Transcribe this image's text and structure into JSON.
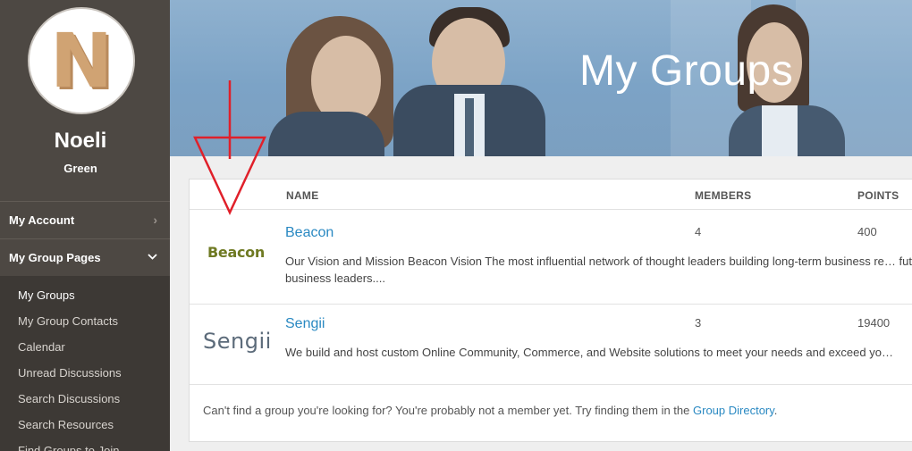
{
  "profile": {
    "avatar_letter": "N",
    "first_name": "Noeli",
    "last_name": "Green"
  },
  "sidebar": {
    "my_account": "My Account",
    "my_group_pages": "My Group Pages",
    "items": [
      {
        "label": "My Groups",
        "active": true
      },
      {
        "label": "My Group Contacts"
      },
      {
        "label": "Calendar"
      },
      {
        "label": "Unread Discussions"
      },
      {
        "label": "Search Discussions"
      },
      {
        "label": "Search Resources"
      },
      {
        "label": "Find Groups to Join"
      }
    ]
  },
  "hero": {
    "title": "My Groups"
  },
  "table": {
    "headers": {
      "name": "NAME",
      "members": "MEMBERS",
      "points": "POINTS"
    },
    "rows": [
      {
        "logo_text": "Beacon",
        "name": "Beacon",
        "members": "4",
        "points": "400",
        "description": "Our Vision and Mission Beacon Vision The most influential network of thought leaders building long-term business re… future business leaders...."
      },
      {
        "logo_text": "Sengii",
        "name": "Sengii",
        "members": "3",
        "points": "19400",
        "description": "We build and host custom Online Community, Commerce, and Website solutions to meet your needs and exceed yo…"
      }
    ]
  },
  "footer": {
    "text": "Can't find a group you're looking for? You're probably not a member yet. Try finding them in the ",
    "link": "Group Directory",
    "after": "."
  },
  "colors": {
    "sidebar_bg": "#4d4843",
    "link": "#2a89c2",
    "annotation": "#e0202a"
  }
}
